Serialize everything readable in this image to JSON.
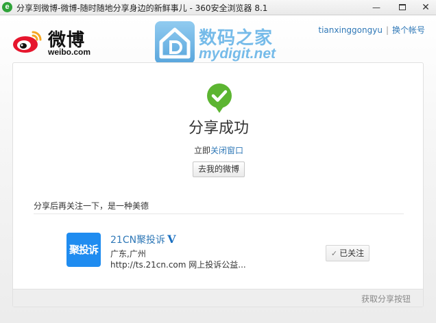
{
  "window": {
    "title": "分享到微博-微博-随时随地分享身边的新鲜事儿 - 360安全浏览器 8.1",
    "app_icon_glyph": "e",
    "minimize": "—",
    "close": "✕"
  },
  "header": {
    "logo_text": "微博",
    "logo_sub": "weibo.com",
    "watermark_cn": "数码之家",
    "watermark_en": "mydigit.net",
    "username": "tianxinggongyu",
    "separator": "|",
    "switch_account": "换个帐号"
  },
  "result": {
    "title": "分享成功",
    "close_prefix": "立即",
    "close_link": "关闭窗口",
    "my_weibo_button": "去我的微博"
  },
  "follow": {
    "tip": "分享后再关注一下，是一种美德",
    "account": {
      "avatar_text": "聚投诉",
      "name": "21CN聚投诉",
      "verified_badge": "V",
      "location": "广东,广州",
      "description": "http://ts.21cn.com 网上投诉公益..."
    },
    "followed_check": "✓",
    "followed_label": "已关注"
  },
  "footer": {
    "get_share_button": "获取分享按钮"
  },
  "colors": {
    "link": "#2f78b7",
    "success_green": "#5cb531",
    "avatar_blue": "#1f8cf0",
    "weibo_red": "#e6162d",
    "weibo_orange": "#f5a623"
  }
}
